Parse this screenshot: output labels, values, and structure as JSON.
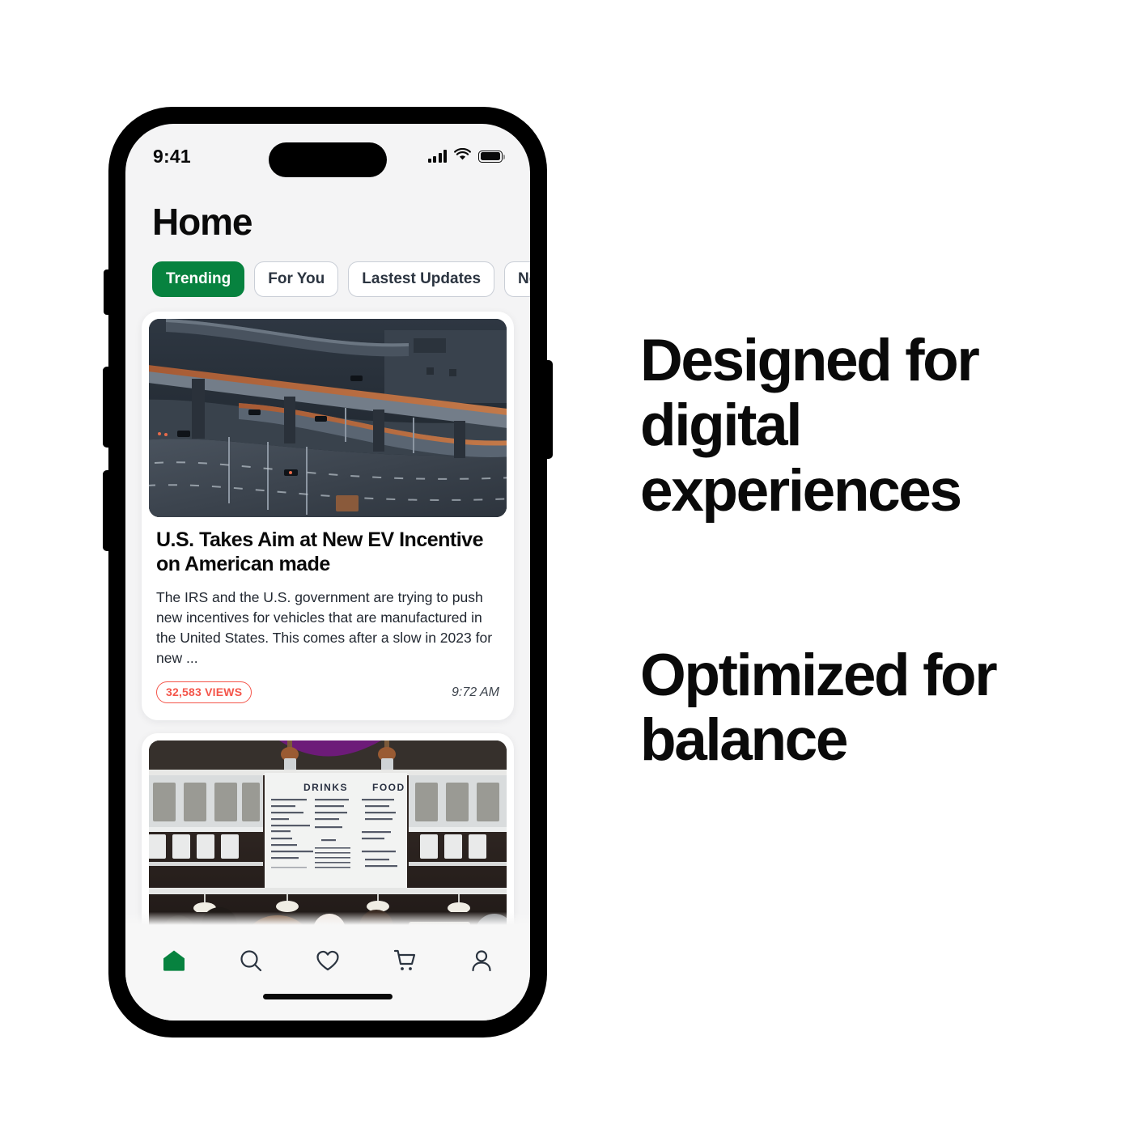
{
  "phone": {
    "status_bar": {
      "time": "9:41",
      "signal_icon": "cellular-signal-icon",
      "wifi_icon": "wifi-icon",
      "battery_icon": "battery-full-icon"
    },
    "header": {
      "title": "Home"
    },
    "tabs": [
      {
        "label": "Trending",
        "active": true
      },
      {
        "label": "For You",
        "active": false
      },
      {
        "label": "Lastest Updates",
        "active": false
      },
      {
        "label": "New Items",
        "active": false
      }
    ],
    "feed": [
      {
        "image_alt": "aerial-view-of-highway-interchange-overpasses",
        "title": "U.S. Takes Aim at New EV Incentive on American made",
        "description": "The IRS and the U.S. government are trying to push new incentives for vehicles that are manufactured in the United States. This comes after a slow in 2023 for new ...",
        "views": "32,583 VIEWS",
        "time": "9:72 AM"
      },
      {
        "image_alt": "coffee-shop-interior-with-drinks-and-food-menu-board"
      }
    ],
    "tabbar": [
      {
        "icon": "home-icon",
        "label": "Home",
        "active": true
      },
      {
        "icon": "search-icon",
        "label": "Search",
        "active": false
      },
      {
        "icon": "heart-icon",
        "label": "Favorites",
        "active": false
      },
      {
        "icon": "cart-icon",
        "label": "Cart",
        "active": false
      },
      {
        "icon": "person-icon",
        "label": "Profile",
        "active": false
      }
    ]
  },
  "marketing": {
    "headline_1": "Designed for digital experiences",
    "headline_2": "Optimized for balance"
  },
  "colors": {
    "accent_green": "#07823f",
    "badge_red": "#f4554a",
    "text_primary": "#0a0a0a",
    "screen_bg": "#f4f4f5"
  }
}
